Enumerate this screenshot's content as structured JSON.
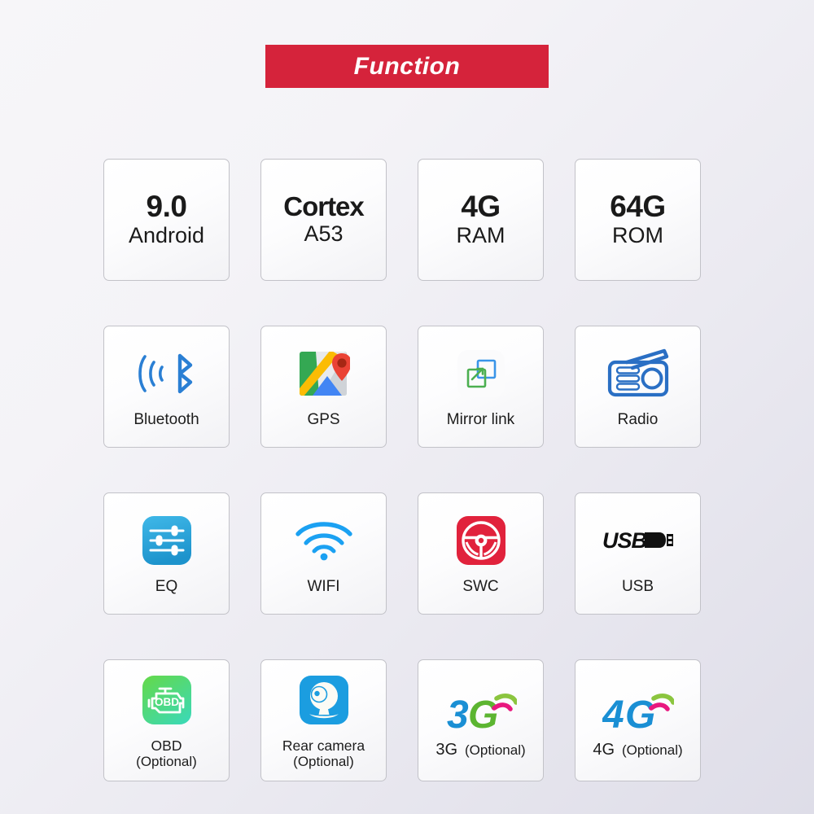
{
  "header": {
    "title": "Function",
    "banner_color": "#d5233b",
    "title_color": "#ffffff"
  },
  "theme": {
    "background_start": "#f7f6f9",
    "background_end": "#dedde8",
    "card_border": "#c2c2c8",
    "text_color": "#1a1a1a",
    "bluetooth_blue": "#2a7fd4",
    "radio_blue": "#2a6fc4",
    "wifi_blue": "#1ba1f2",
    "eq_blue": "#29a9dd",
    "swc_red": "#e1223c",
    "obd_green": "#4cd964",
    "camera_blue": "#1b9de0",
    "gen_blue": "#1a8fd4",
    "gen_green": "#5cb531",
    "gen_pink": "#e8187f"
  },
  "grid": {
    "rows": 4,
    "columns": 4,
    "cards": [
      {
        "id": "android-version",
        "type": "text",
        "icon": null,
        "big": "9.0",
        "sub": "Android",
        "label": null,
        "sublabel": null
      },
      {
        "id": "cpu",
        "type": "text",
        "icon": null,
        "big": "Cortex",
        "sub": "A53",
        "label": null,
        "sublabel": null
      },
      {
        "id": "ram",
        "type": "text",
        "icon": null,
        "big": "4G",
        "sub": "RAM",
        "label": null,
        "sublabel": null
      },
      {
        "id": "rom",
        "type": "text",
        "icon": null,
        "big": "64G",
        "sub": "ROM",
        "label": null,
        "sublabel": null
      },
      {
        "id": "bluetooth",
        "type": "icon",
        "icon": "bluetooth-icon",
        "big": null,
        "sub": null,
        "label": "Bluetooth",
        "sublabel": null
      },
      {
        "id": "gps",
        "type": "icon",
        "icon": "gps-map-icon",
        "big": null,
        "sub": null,
        "label": "GPS",
        "sublabel": null
      },
      {
        "id": "mirror-link",
        "type": "icon",
        "icon": "mirror-link-icon",
        "big": null,
        "sub": null,
        "label": "Mirror link",
        "sublabel": null
      },
      {
        "id": "radio",
        "type": "icon",
        "icon": "radio-icon",
        "big": null,
        "sub": null,
        "label": "Radio",
        "sublabel": null
      },
      {
        "id": "eq",
        "type": "icon",
        "icon": "equalizer-icon",
        "big": null,
        "sub": null,
        "label": "EQ",
        "sublabel": null
      },
      {
        "id": "wifi",
        "type": "icon",
        "icon": "wifi-icon",
        "big": null,
        "sub": null,
        "label": "WIFI",
        "sublabel": null
      },
      {
        "id": "swc",
        "type": "icon",
        "icon": "steering-wheel-icon",
        "big": null,
        "sub": null,
        "label": "SWC",
        "sublabel": null
      },
      {
        "id": "usb",
        "type": "icon",
        "icon": "usb-icon",
        "big": null,
        "sub": null,
        "label": "USB",
        "sublabel": null
      },
      {
        "id": "obd",
        "type": "icon",
        "icon": "obd-engine-icon",
        "big": null,
        "sub": null,
        "label": "OBD",
        "sublabel": "(Optional)"
      },
      {
        "id": "rear-camera",
        "type": "icon",
        "icon": "camera-icon",
        "big": null,
        "sub": null,
        "label": "Rear camera",
        "sublabel": "(Optional)"
      },
      {
        "id": "3g",
        "type": "icon",
        "icon": "3g-signal-icon",
        "big": null,
        "sub": null,
        "label": "3G",
        "sublabel": "(Optional)"
      },
      {
        "id": "4g",
        "type": "icon",
        "icon": "4g-signal-icon",
        "big": null,
        "sub": null,
        "label": "4G",
        "sublabel": "(Optional)"
      }
    ]
  }
}
